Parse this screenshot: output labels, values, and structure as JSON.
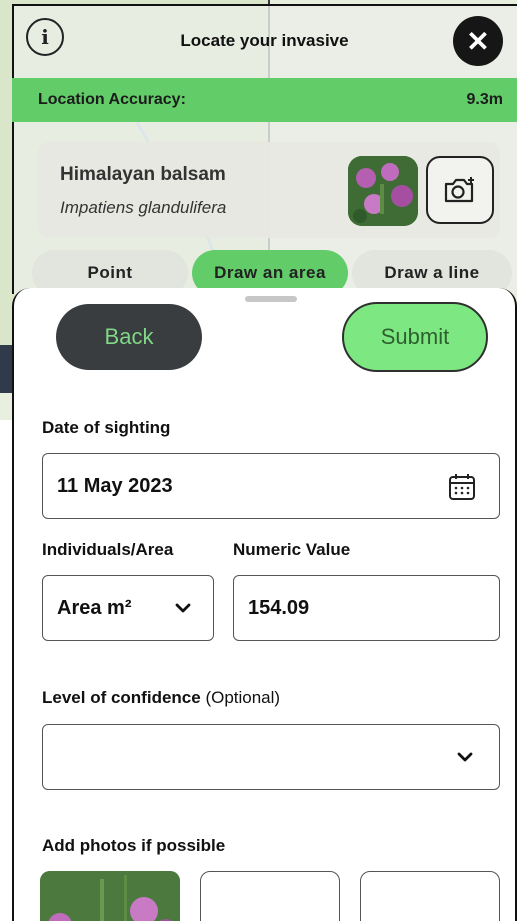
{
  "header": {
    "title": "Locate your invasive",
    "info_icon": "info-icon",
    "close_icon": "close-icon"
  },
  "accuracy": {
    "label": "Location Accuracy:",
    "value": "9.3m"
  },
  "species": {
    "common_name": "Himalayan balsam",
    "latin_name": "Impatiens glandulifera"
  },
  "modes": [
    {
      "label": "Point",
      "active": false
    },
    {
      "label": "Draw an area",
      "active": true
    },
    {
      "label": "Draw a line",
      "active": false
    }
  ],
  "actions": {
    "back": "Back",
    "submit": "Submit"
  },
  "form": {
    "date_label": "Date of sighting",
    "date_value": "11 May 2023",
    "individuals_label": "Individuals/Area",
    "individuals_value": "Area m²",
    "numeric_label": "Numeric Value",
    "numeric_value": "154.09",
    "confidence_label": "Level of confidence",
    "confidence_optional": "(Optional)",
    "confidence_value": "",
    "photos_label": "Add photos if possible"
  },
  "colors": {
    "accent_green": "#62cc68",
    "submit_green": "#7de881",
    "dark": "#3a3d3f"
  }
}
